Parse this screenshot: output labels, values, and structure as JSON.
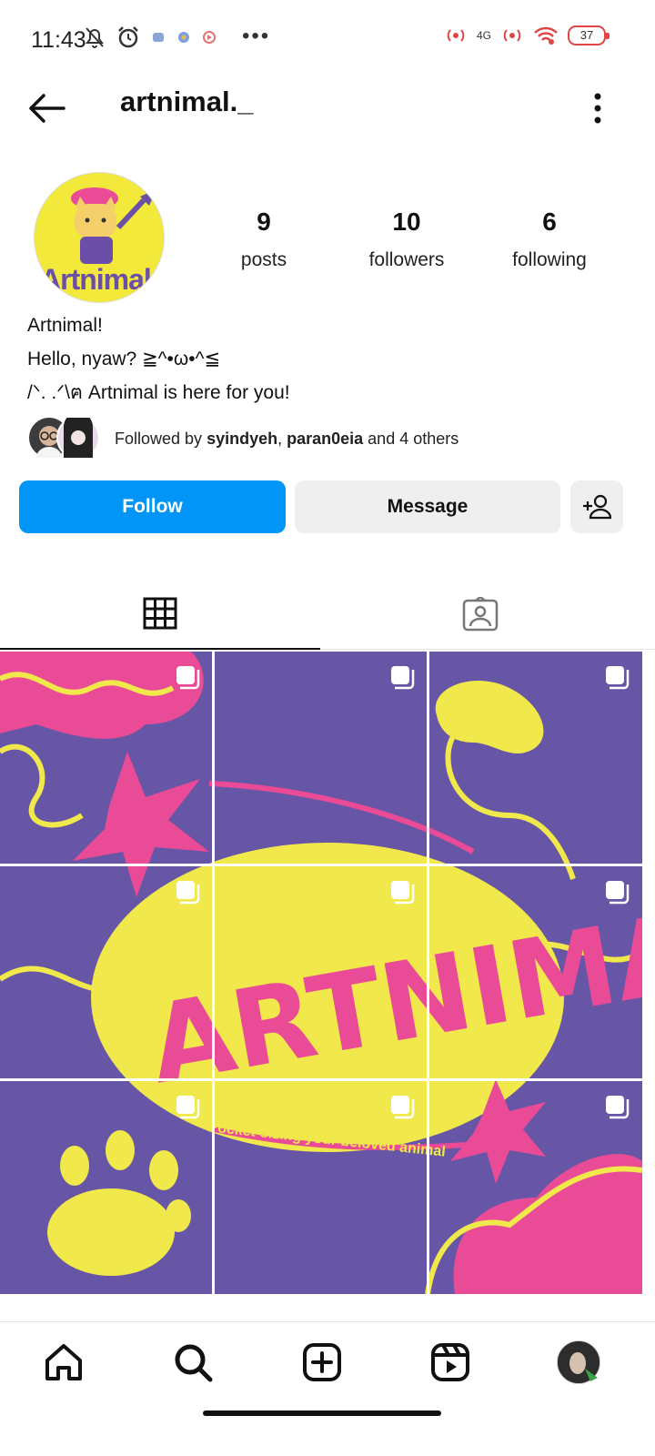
{
  "status_bar": {
    "time": "11:43",
    "more": "•••",
    "network": "4G",
    "battery": "37"
  },
  "header": {
    "username": "artnimal._"
  },
  "profile": {
    "avatar_text": "Artnimal",
    "stats": {
      "posts_count": "9",
      "posts_label": "posts",
      "followers_count": "10",
      "followers_label": "followers",
      "following_count": "6",
      "following_label": "following"
    },
    "bio": {
      "name": "Artnimal!",
      "line1": "Hello, nyaw? ≧^•ω•^≦",
      "line2": "/ᐠ. .ᐟ\\ฅ Artnimal is here for you!"
    },
    "followed_by": {
      "prefix": "Followed by ",
      "user1": "syindyeh",
      "sep": ", ",
      "user2": "paran0eia",
      "suffix": " and 4 others"
    }
  },
  "actions": {
    "follow_label": "Follow",
    "message_label": "Message"
  },
  "grid": {
    "tagline": "Pocket-sizing your beloved animal",
    "art_text": "ARTNIMAL"
  },
  "colors": {
    "accent": "#0095f6",
    "post_purple": "#6756a5",
    "post_pink": "#e94b97",
    "post_yellow": "#f1e84b"
  }
}
